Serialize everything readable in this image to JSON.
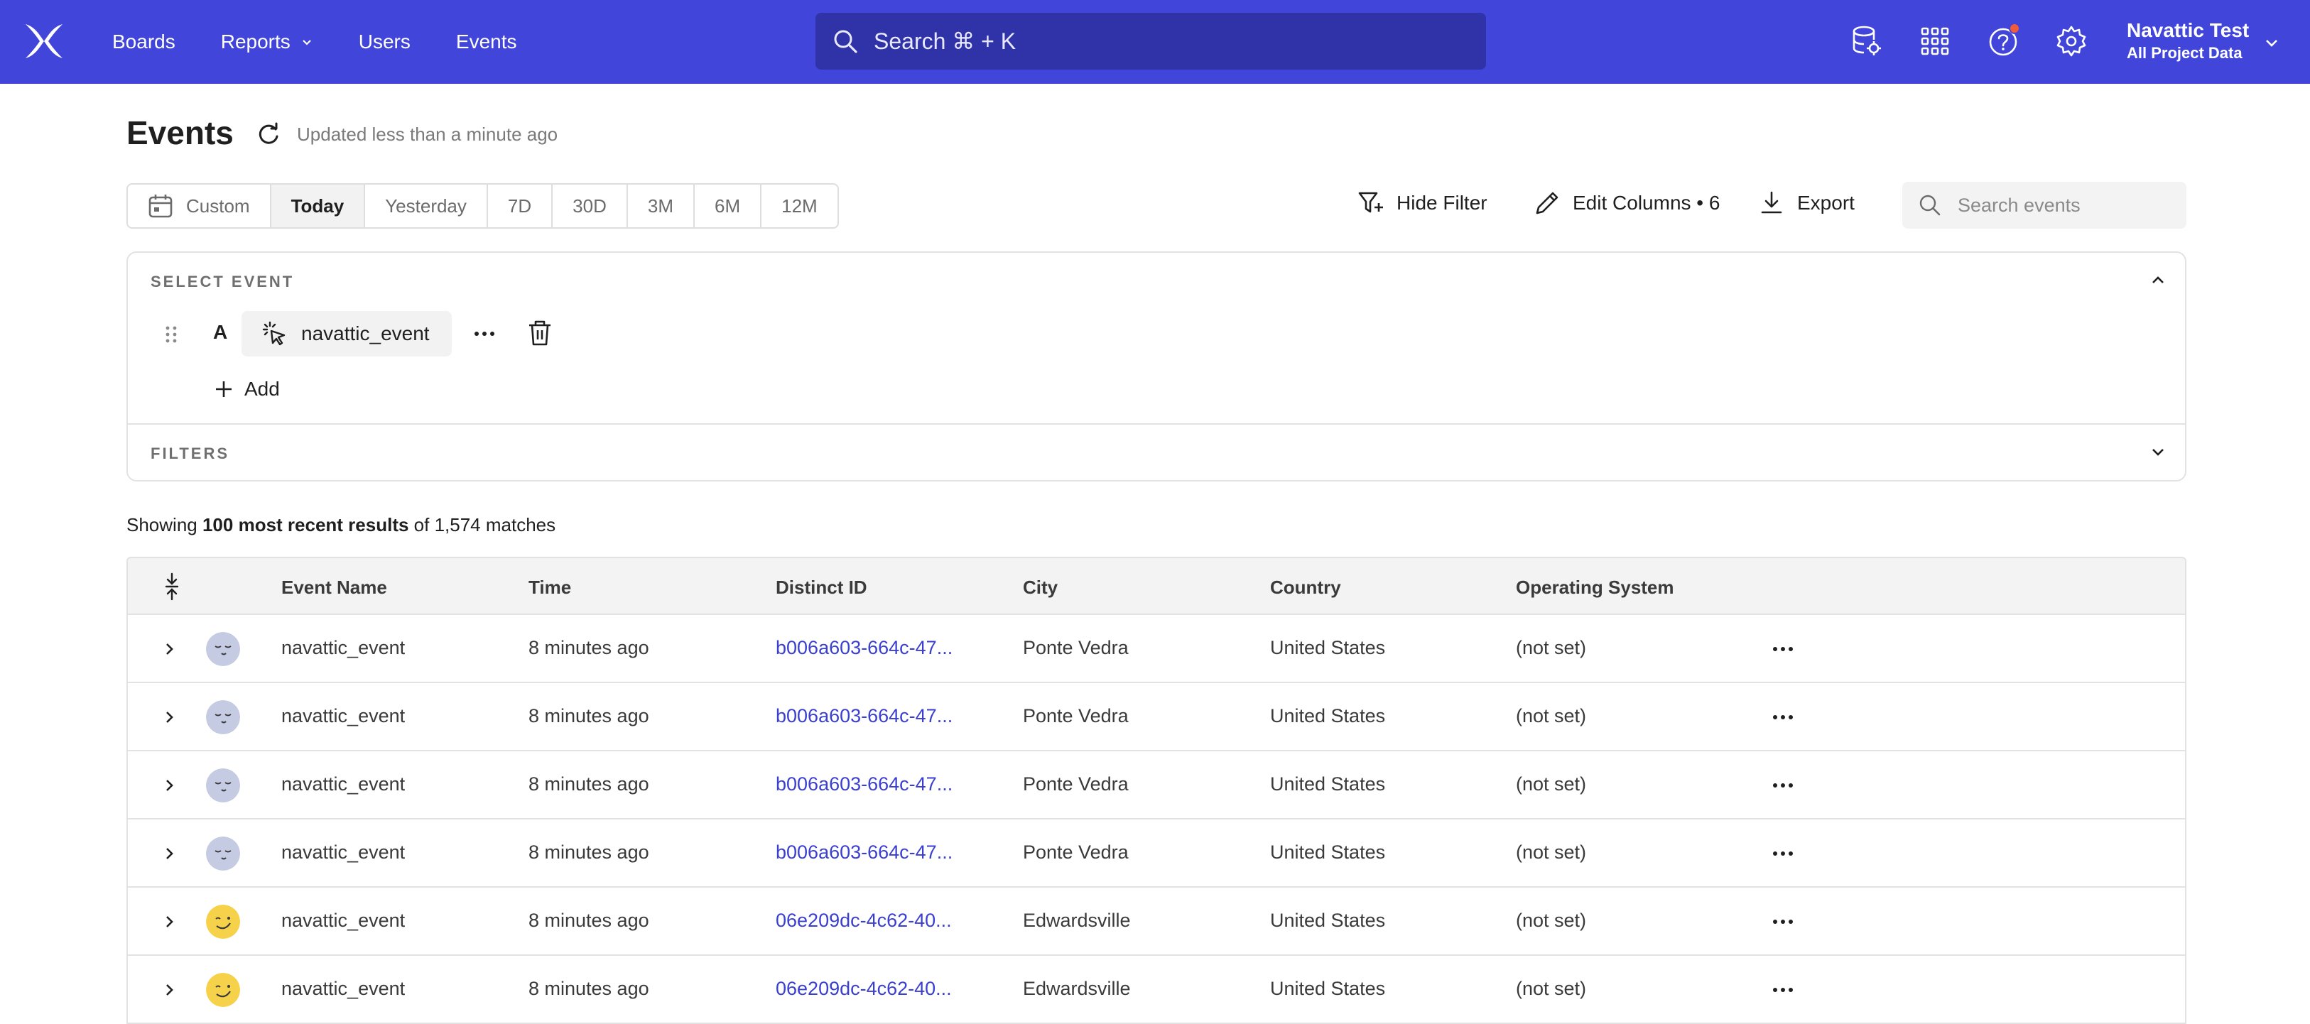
{
  "nav": {
    "links": [
      {
        "label": "Boards"
      },
      {
        "label": "Reports",
        "has_dropdown": true
      },
      {
        "label": "Users"
      },
      {
        "label": "Events"
      }
    ],
    "search_label": "Search ⌘ + K",
    "account": {
      "name": "Navattic Test",
      "project": "All Project Data"
    },
    "icons": [
      "data-icon",
      "apps-grid-icon",
      "help-icon",
      "gear-icon"
    ],
    "colors": {
      "bar": "#4145d9",
      "search": "#3032a8",
      "notification": "#f25a3c"
    }
  },
  "header": {
    "title": "Events",
    "updated": "Updated less than a minute ago"
  },
  "ranges": [
    {
      "label": "Custom",
      "icon": "calendar-icon"
    },
    {
      "label": "Today",
      "active": true
    },
    {
      "label": "Yesterday"
    },
    {
      "label": "7D"
    },
    {
      "label": "30D"
    },
    {
      "label": "3M"
    },
    {
      "label": "6M"
    },
    {
      "label": "12M"
    }
  ],
  "actions": {
    "hide_filter": "Hide Filter",
    "edit_columns": "Edit Columns • 6",
    "export": "Export",
    "search_placeholder": "Search events"
  },
  "select_event": {
    "label": "SELECT EVENT",
    "letter": "A",
    "event": "navattic_event",
    "add": "Add",
    "filters_label": "FILTERS"
  },
  "results": {
    "prefix": "Showing ",
    "bold": "100 most recent results",
    "suffix": " of 1,574 matches"
  },
  "table": {
    "columns": [
      "Event Name",
      "Time",
      "Distinct ID",
      "City",
      "Country",
      "Operating System"
    ],
    "rows": [
      {
        "avatar": "sleepy",
        "event": "navattic_event",
        "time": "8 minutes ago",
        "distinct_id": "b006a603-664c-47...",
        "city": "Ponte Vedra",
        "country": "United States",
        "os": "(not set)"
      },
      {
        "avatar": "sleepy",
        "event": "navattic_event",
        "time": "8 minutes ago",
        "distinct_id": "b006a603-664c-47...",
        "city": "Ponte Vedra",
        "country": "United States",
        "os": "(not set)"
      },
      {
        "avatar": "sleepy",
        "event": "navattic_event",
        "time": "8 minutes ago",
        "distinct_id": "b006a603-664c-47...",
        "city": "Ponte Vedra",
        "country": "United States",
        "os": "(not set)"
      },
      {
        "avatar": "sleepy",
        "event": "navattic_event",
        "time": "8 minutes ago",
        "distinct_id": "b006a603-664c-47...",
        "city": "Ponte Vedra",
        "country": "United States",
        "os": "(not set)"
      },
      {
        "avatar": "smile",
        "event": "navattic_event",
        "time": "8 minutes ago",
        "distinct_id": "06e209dc-4c62-40...",
        "city": "Edwardsville",
        "country": "United States",
        "os": "(not set)"
      },
      {
        "avatar": "smile",
        "event": "navattic_event",
        "time": "8 minutes ago",
        "distinct_id": "06e209dc-4c62-40...",
        "city": "Edwardsville",
        "country": "United States",
        "os": "(not set)"
      }
    ],
    "avatar_colors": {
      "sleepy": "#c5cbe3",
      "smile": "#f6d24a"
    },
    "link_color": "#3a3fd0"
  }
}
